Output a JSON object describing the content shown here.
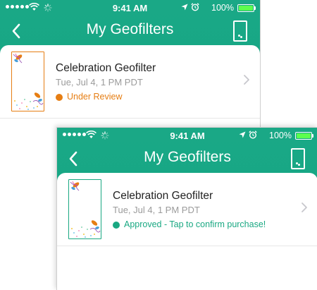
{
  "screens": [
    {
      "status_bar": {
        "time": "9:41 AM",
        "battery": "100%",
        "battery_level": 1.0
      },
      "header": {
        "title": "My Geofilters"
      },
      "item": {
        "title": "Celebration Geofilter",
        "date": "Tue, Jul 4, 1 PM PDT",
        "status": "Under Review",
        "status_color": "#e67e13"
      }
    },
    {
      "status_bar": {
        "time": "9:41 AM",
        "battery": "100%",
        "battery_level": 1.0
      },
      "header": {
        "title": "My Geofilters"
      },
      "item": {
        "title": "Celebration Geofilter",
        "date": "Tue, Jul 4, 1 PM PDT",
        "status": "Approved - Tap to confirm purchase!",
        "status_color": "#19a882"
      }
    }
  ],
  "colors": {
    "header_green": "#18a785",
    "chevron_gray": "#c7c7cc"
  },
  "icons": [
    "back-chevron-icon",
    "filter-frame-icon",
    "location-arrow-icon",
    "alarm-clock-icon",
    "wifi-icon",
    "battery-icon",
    "chevron-right-icon"
  ]
}
